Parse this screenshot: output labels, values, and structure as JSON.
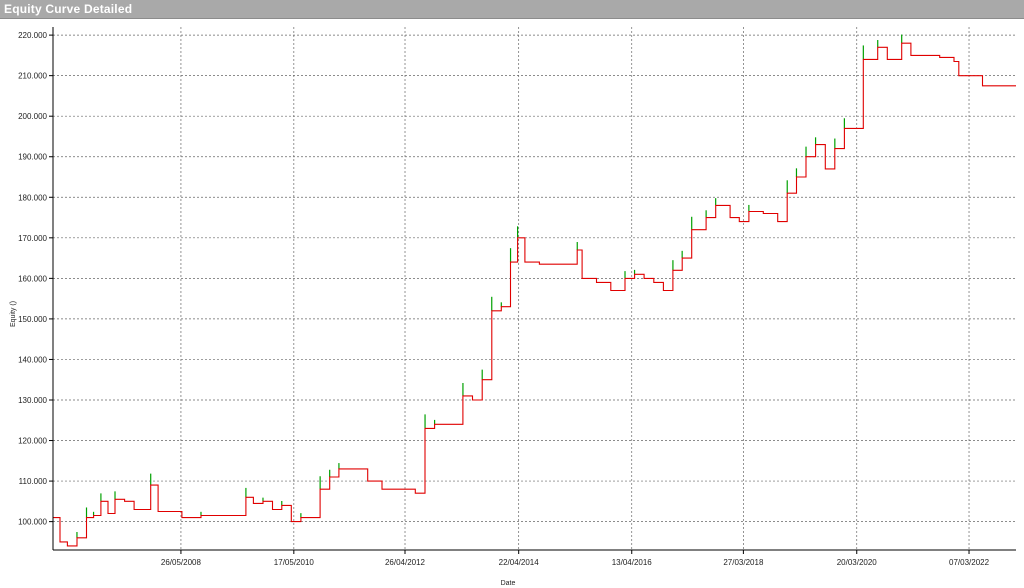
{
  "window": {
    "title": "Equity Curve Detailed"
  },
  "colors": {
    "equity_line": "#e00000",
    "up_spikes": "#00a000",
    "grid": "#666666",
    "background": "#ffffff"
  },
  "chart_data": {
    "type": "line",
    "title": "Equity Curve Detailed",
    "xlabel": "Date",
    "ylabel": "Equity ()",
    "xlim": [
      "2006-03-01",
      "2023-01-01"
    ],
    "ylim": [
      93000,
      222000
    ],
    "x_ticks": [
      "26/05/2008",
      "17/05/2010",
      "26/04/2012",
      "22/04/2014",
      "13/04/2016",
      "27/03/2018",
      "20/03/2020",
      "07/03/2022"
    ],
    "y_ticks": [
      "100.000",
      "110.000",
      "120.000",
      "130.000",
      "140.000",
      "150.000",
      "160.000",
      "170.000",
      "180.000",
      "190.000",
      "200.000",
      "210.000",
      "220.000"
    ],
    "grid": true,
    "series": [
      {
        "values": [
          [
            "2006-03-01",
            101000
          ],
          [
            "2006-04-15",
            95000
          ],
          [
            "2006-06-01",
            94000
          ],
          [
            "2006-08-01",
            96000
          ],
          [
            "2006-10-01",
            101000
          ],
          [
            "2006-11-15",
            101500
          ],
          [
            "2007-01-01",
            105000
          ],
          [
            "2007-02-15",
            102000
          ],
          [
            "2007-04-01",
            105500
          ],
          [
            "2007-06-01",
            105000
          ],
          [
            "2007-08-01",
            103000
          ],
          [
            "2007-10-01",
            103000
          ],
          [
            "2007-11-15",
            109000
          ],
          [
            "2008-01-01",
            102500
          ],
          [
            "2008-06-01",
            101000
          ],
          [
            "2008-10-01",
            101500
          ],
          [
            "2009-06-01",
            101500
          ],
          [
            "2009-07-15",
            106000
          ],
          [
            "2009-09-01",
            104500
          ],
          [
            "2009-11-01",
            105000
          ],
          [
            "2010-01-01",
            103000
          ],
          [
            "2010-03-01",
            104000
          ],
          [
            "2010-05-01",
            100000
          ],
          [
            "2010-07-01",
            101000
          ],
          [
            "2010-09-01",
            101000
          ],
          [
            "2010-11-01",
            108000
          ],
          [
            "2011-01-01",
            111000
          ],
          [
            "2011-03-01",
            113000
          ],
          [
            "2011-06-01",
            113000
          ],
          [
            "2011-09-01",
            110000
          ],
          [
            "2011-12-01",
            108000
          ],
          [
            "2012-05-01",
            108000
          ],
          [
            "2012-07-01",
            107000
          ],
          [
            "2012-09-01",
            123000
          ],
          [
            "2012-11-01",
            124000
          ],
          [
            "2013-03-01",
            124000
          ],
          [
            "2013-05-01",
            131000
          ],
          [
            "2013-07-01",
            130000
          ],
          [
            "2013-09-01",
            135000
          ],
          [
            "2013-11-01",
            152000
          ],
          [
            "2014-01-01",
            153000
          ],
          [
            "2014-03-01",
            164000
          ],
          [
            "2014-04-15",
            170000
          ],
          [
            "2014-06-01",
            164000
          ],
          [
            "2014-09-01",
            163500
          ],
          [
            "2015-01-01",
            163500
          ],
          [
            "2015-04-01",
            163500
          ],
          [
            "2015-05-01",
            167000
          ],
          [
            "2015-06-01",
            160000
          ],
          [
            "2015-09-01",
            159000
          ],
          [
            "2015-12-01",
            157000
          ],
          [
            "2016-03-01",
            160000
          ],
          [
            "2016-05-01",
            161000
          ],
          [
            "2016-07-01",
            160000
          ],
          [
            "2016-09-01",
            159000
          ],
          [
            "2016-11-01",
            157000
          ],
          [
            "2017-01-01",
            162000
          ],
          [
            "2017-03-01",
            165000
          ],
          [
            "2017-05-01",
            172000
          ],
          [
            "2017-08-01",
            175000
          ],
          [
            "2017-10-01",
            178000
          ],
          [
            "2018-01-01",
            175000
          ],
          [
            "2018-03-01",
            174000
          ],
          [
            "2018-05-01",
            176500
          ],
          [
            "2018-08-01",
            176000
          ],
          [
            "2018-11-01",
            174000
          ],
          [
            "2019-01-01",
            181000
          ],
          [
            "2019-03-01",
            185000
          ],
          [
            "2019-05-01",
            190000
          ],
          [
            "2019-07-01",
            193000
          ],
          [
            "2019-09-01",
            187000
          ],
          [
            "2019-11-01",
            192000
          ],
          [
            "2020-01-01",
            197000
          ],
          [
            "2020-03-01",
            197000
          ],
          [
            "2020-05-01",
            214000
          ],
          [
            "2020-08-01",
            217000
          ],
          [
            "2020-10-01",
            214000
          ],
          [
            "2021-01-01",
            218000
          ],
          [
            "2021-03-01",
            215000
          ],
          [
            "2021-06-01",
            215000
          ],
          [
            "2021-09-01",
            214500
          ],
          [
            "2021-12-01",
            213500
          ],
          [
            "2022-01-01",
            210000
          ],
          [
            "2022-04-01",
            210000
          ],
          [
            "2022-06-01",
            207500
          ],
          [
            "2023-01-01",
            207500
          ]
        ]
      }
    ]
  }
}
